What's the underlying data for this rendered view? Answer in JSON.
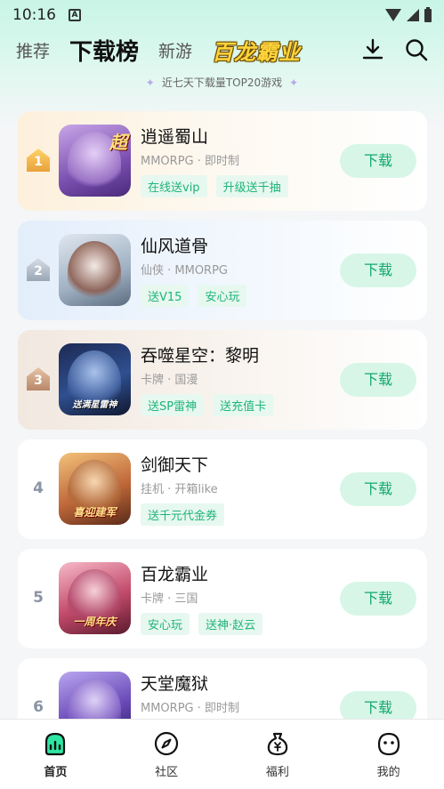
{
  "status_bar": {
    "time": "10:16",
    "notification_letter": "A"
  },
  "nav": {
    "tabs": [
      {
        "label": "推荐",
        "active": false
      },
      {
        "label": "下载榜",
        "active": true
      },
      {
        "label": "新游",
        "active": false
      }
    ],
    "brand": "百龙霸业",
    "icons": [
      "download-icon",
      "search-icon"
    ]
  },
  "subtitle": "近七天下载量TOP20游戏",
  "games": [
    {
      "rank": "1",
      "name": "逍遥蜀山",
      "meta": "MMORPG · 即时制",
      "tags": [
        "在线送vip",
        "升级送千抽"
      ],
      "button": "下载",
      "icon_caption": "超"
    },
    {
      "rank": "2",
      "name": "仙风道骨",
      "meta": "仙侠 · MMORPG",
      "tags": [
        "送V15",
        "安心玩"
      ],
      "button": "下载",
      "icon_caption": ""
    },
    {
      "rank": "3",
      "name": "吞噬星空：黎明",
      "meta": "卡牌 · 国漫",
      "tags": [
        "送SP雷神",
        "送充值卡"
      ],
      "button": "下载",
      "icon_caption": "送满星雷神"
    },
    {
      "rank": "4",
      "name": "剑御天下",
      "meta": "挂机 · 开箱like",
      "tags": [
        "送千元代金券"
      ],
      "button": "下载",
      "icon_caption": "喜迎建军"
    },
    {
      "rank": "5",
      "name": "百龙霸业",
      "meta": "卡牌 · 三国",
      "tags": [
        "安心玩",
        "送神·赵云"
      ],
      "button": "下载",
      "icon_caption": "一周年庆"
    },
    {
      "rank": "6",
      "name": "天堂魔狱",
      "meta": "MMORPG · 即时制",
      "tags": [],
      "button": "下载",
      "icon_caption": ""
    }
  ],
  "bottom_nav": [
    {
      "label": "首页",
      "icon": "home-icon",
      "active": true
    },
    {
      "label": "社区",
      "icon": "compass-icon",
      "active": false
    },
    {
      "label": "福利",
      "icon": "money-bag-icon",
      "active": false
    },
    {
      "label": "我的",
      "icon": "face-icon",
      "active": false
    }
  ],
  "colors": {
    "accent": "#1fb47a",
    "button_bg": "#d7f6e8",
    "header_gradient": "#c8f5e6"
  }
}
